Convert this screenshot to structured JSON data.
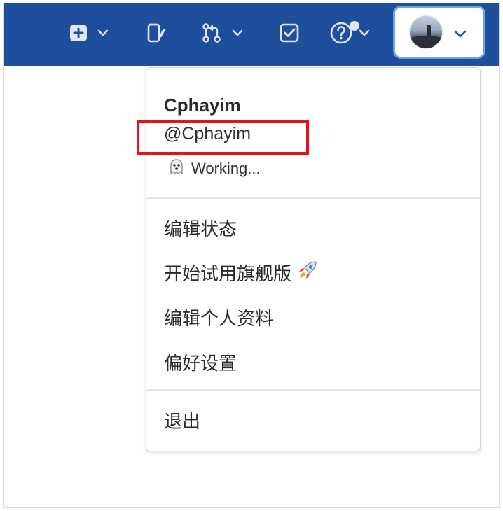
{
  "navbar": {
    "color": "#1f4e9c",
    "items": [
      {
        "icon": "plus-square-icon",
        "has_chevron": true
      },
      {
        "icon": "issues-icon",
        "has_chevron": false
      },
      {
        "icon": "merge-request-icon",
        "has_chevron": true
      },
      {
        "icon": "todo-checkbox-icon",
        "has_chevron": false
      },
      {
        "icon": "help-icon",
        "has_chevron": true,
        "notification_dot": true
      }
    ],
    "user_menu": {
      "avatar": "avatar",
      "icon": "chevron-down-icon"
    }
  },
  "dropdown": {
    "user": {
      "name": "Cphayim",
      "handle": "@Cphayim",
      "status_emoji": "ghost-icon",
      "status_text": "Working..."
    },
    "highlight_color": "#e8101a",
    "menu": [
      {
        "label": "编辑状态"
      },
      {
        "label": "开始试用旗舰版",
        "emoji": "rocket-icon"
      },
      {
        "label": "编辑个人资料"
      },
      {
        "label": "偏好设置"
      }
    ],
    "sign_out": {
      "label": "退出"
    }
  }
}
